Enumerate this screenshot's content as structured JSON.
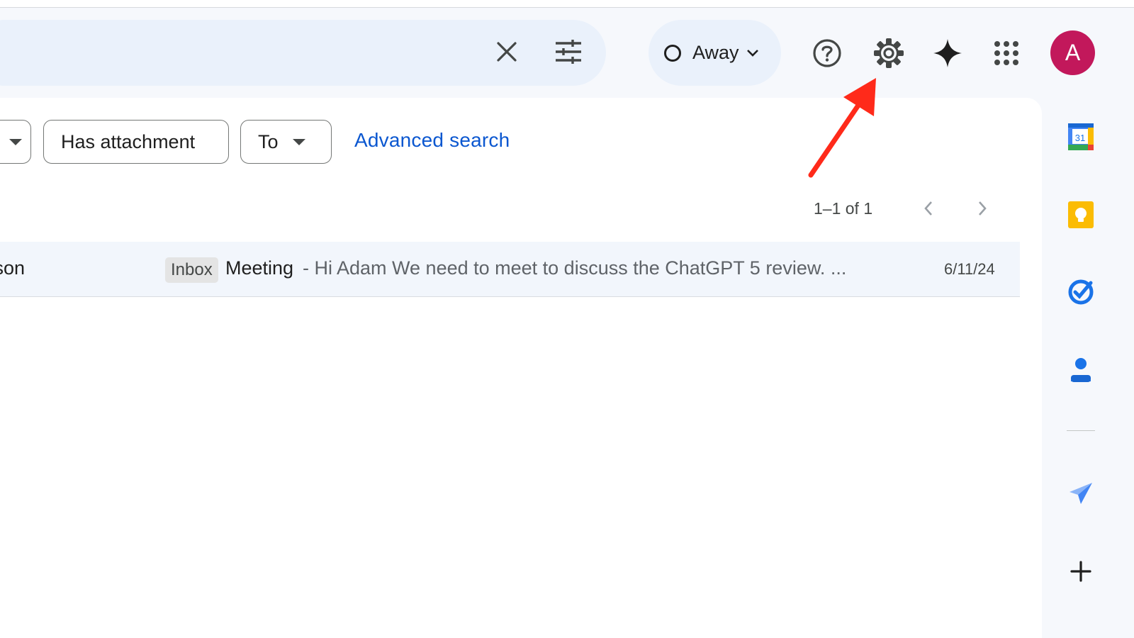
{
  "search": {
    "clear_icon": "close-icon",
    "options_icon": "tune-icon"
  },
  "status": {
    "label": "Away",
    "indicator_icon": "status-ring-icon"
  },
  "header_icons": [
    "help-icon",
    "settings-icon",
    "gemini-sparkle-icon",
    "apps-grid-icon"
  ],
  "account": {
    "initial": "A",
    "color": "#c2185b"
  },
  "filters": {
    "chips": [
      "Has attachment",
      "To"
    ],
    "advanced_search_label": "Advanced search"
  },
  "pagination": {
    "range_text": "1–1 of 1"
  },
  "emails": [
    {
      "sender_fragment": "son",
      "label": "Inbox",
      "subject": "Meeting",
      "snippet": " - Hi Adam We need to meet to discuss the ChatGPT 5 review. ...",
      "date": "6/11/24"
    }
  ],
  "side_panel": {
    "calendar_day": "31",
    "apps": [
      "calendar-icon",
      "keep-icon",
      "tasks-icon",
      "contacts-icon",
      "send-icon",
      "add-icon"
    ]
  },
  "colors": {
    "accent": "#0b57d0",
    "annotation_arrow": "#ff2a1a",
    "background": "#f6f8fc",
    "search_bg": "#eaf1fb"
  }
}
